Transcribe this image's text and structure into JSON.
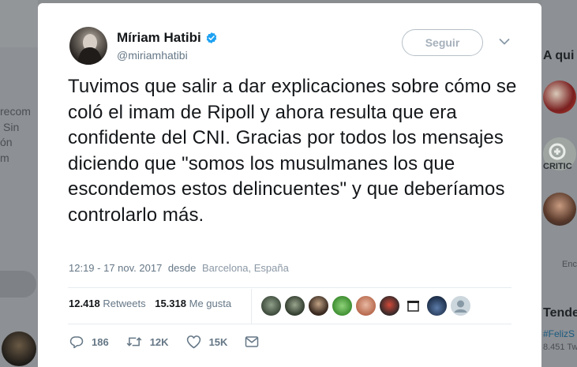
{
  "background": {
    "left_fragments": [
      "recom",
      "Sin",
      "ón",
      "m"
    ],
    "right_heading": "A qui",
    "right_label_critic": "CRITIC",
    "right_label_enc": "Enc",
    "trends_heading": "Tende",
    "trend_tag": "#FelizS",
    "trend_count": "8.451 Tw"
  },
  "tweet": {
    "author_name": "Míriam Hatibi",
    "author_handle": "@miriamhatibi",
    "follow_label": "Seguir",
    "text": "Tuvimos que salir a dar explicaciones sobre cómo se coló el imam de Ripoll y ahora resulta que era confidente del CNI. Gracias por todos los mensajes diciendo que \"somos los musulmanes los que escondemos estos delincuentes\" y que deberíamos controlarlo más.",
    "time": "12:19 - 17 nov. 2017",
    "from_word": "desde",
    "location_city": "Barcelona",
    "location_sep": ", ",
    "location_country": "España",
    "retweets_count": "12.418",
    "retweets_label": "Retweets",
    "likes_count": "15.318",
    "likes_label": "Me gusta",
    "replies": "186",
    "retweets_short": "12K",
    "likes_short": "15K"
  },
  "colors": {
    "verified": "#1da1f2",
    "text": "#14171a",
    "muted": "#657786"
  },
  "icons": [
    "verified-badge-icon",
    "chevron-down-icon",
    "reply-icon",
    "retweet-icon",
    "like-icon",
    "direct-message-icon"
  ]
}
